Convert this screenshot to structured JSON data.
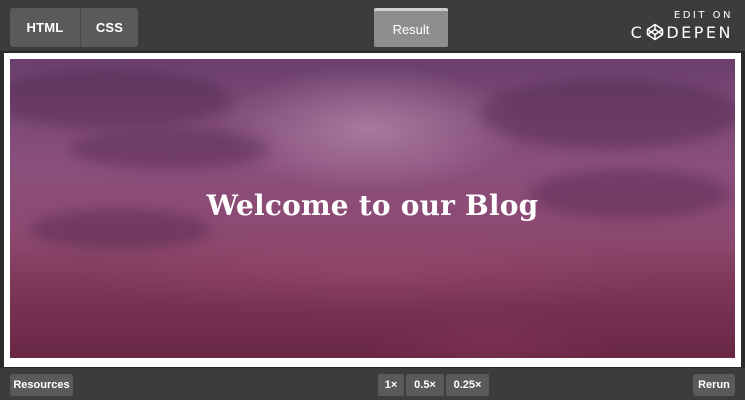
{
  "editor": {
    "tabs": [
      {
        "label": "HTML"
      },
      {
        "label": "CSS"
      }
    ],
    "result_tab_label": "Result"
  },
  "branding": {
    "edit_on": "EDIT ON",
    "codepen_prefix": "C",
    "codepen_suffix": "DEPEN",
    "logo_icon": "codepen-logo-icon"
  },
  "result": {
    "hero_title": "Welcome to our Blog"
  },
  "footer": {
    "resources_label": "Resources",
    "zoom_options": [
      "1×",
      "0.5×",
      "0.25×"
    ],
    "rerun_label": "Rerun"
  },
  "colors": {
    "toolbar_bg": "#3c3c3c",
    "button_bg": "#5a5a5a",
    "active_tab_bg": "#8e8e8e",
    "hero_tint": "#8a4f7c"
  }
}
